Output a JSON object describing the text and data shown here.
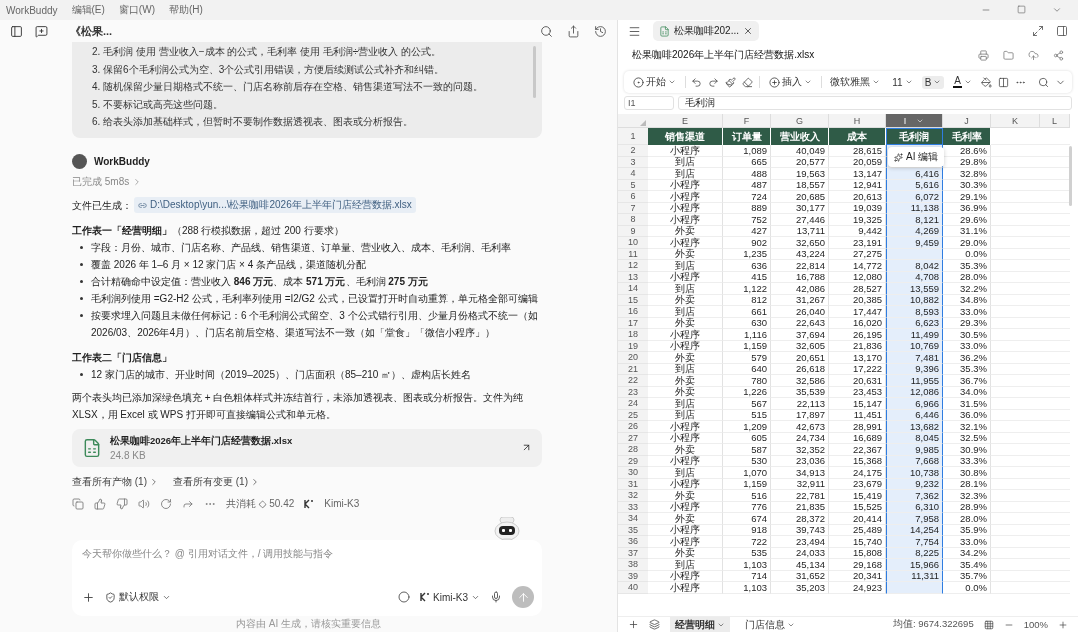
{
  "menu_bar": {
    "app": "WorkBuddy",
    "menus": [
      "编辑(E)",
      "窗口(W)",
      "帮助(H)"
    ]
  },
  "chat": {
    "title": "《松果...",
    "prompt_lines": [
      "2. 毛利润 使用 营业收入−成本 的公式，毛利率 使用 毛利润÷营业收入 的公式。",
      "3. 保留6个毛利润公式为空、3个公式引用错误，方便后续测试公式补齐和纠错。",
      "4. 随机保留少量日期格式不统一、门店名称前后存在空格、销售渠道写法不一致的问题。",
      "5. 不要标记或高亮这些问题。",
      "6. 给表头添加基础样式，但暂时不要制作数据透视表、图表或分析报告。"
    ],
    "assistant": {
      "name": "WorkBuddy",
      "status": "已完成 5m8s"
    },
    "file_label": "文件已生成：",
    "file_path": "D:\\Desktop\\yun...\\松果咖啡2026年上半年门店经营数据.xlsx",
    "sections": [
      {
        "title": "工作表一「经营明细」",
        "note": "（288 行模拟数据，超过 200 行要求）",
        "bullets": [
          "字段：月份、城市、门店名称、产品线、销售渠道、订单量、营业收入、成本、毛利润、毛利率",
          "覆盖 2026 年 1–6 月 × 12 家门店 × 4 条产品线，渠道随机分配",
          "合计精确命中设定值：营业收入 **846 万元**、成本 **571 万元**、毛利润 **275 万元**",
          "毛利润列使用 =G2-H2 公式，毛利率列使用 =I2/G2 公式，已设置打开时自动重算，单元格全部可编辑",
          "按要求埋入问题且未做任何标记：6 个毛利润公式留空、3 个公式错行引用、少量月份格式不统一（如 2026/03、2026年4月）、门店名前后空格、渠道写法不一致（如「堂食」「微信小程序」）"
        ]
      },
      {
        "title": "工作表二「门店信息」",
        "bullets": [
          "12 家门店的城市、开业时间（2019–2025）、门店面积（85–210 ㎡）、虚构店长姓名"
        ]
      }
    ],
    "summary": "两个表头均已添加深绿色填充 + 白色粗体样式并冻结首行，未添加透视表、图表或分析报告。文件为纯 XLSX，用 Excel 或 WPS 打开即可直接编辑公式和单元格。",
    "attachment": {
      "name": "松果咖啡2026年上半年门店经营数据.xlsx",
      "size": "24.8 KB"
    },
    "links": [
      "查看所有产物 (1)",
      "查看所有变更 (1)"
    ],
    "usage": "共消耗 ◇ 50.42",
    "usage_model": "Kimi-K3",
    "input": {
      "placeholder": "今天帮你做些什么？ @ 引用对话文件，/ 调用技能与指令",
      "permission": "默认权限",
      "model": "Kimi-K3"
    },
    "footer": "内容由 AI 生成，请核实重要信息"
  },
  "sheet": {
    "file_tab": {
      "label": "松果咖啡202...",
      "selected": true
    },
    "file_title": "松果咖啡2026年上半年门店经营数据.xlsx",
    "toolbar": {
      "start": "开始",
      "insert": "插入",
      "font": "微软雅黑",
      "size": "11",
      "bold": "B",
      "bold_selected": true,
      "color_letter": "A"
    },
    "cell_ref": "I1",
    "formula": "毛利润",
    "columns": [
      {
        "letter": "E",
        "selected": false
      },
      {
        "letter": "F",
        "selected": false
      },
      {
        "letter": "G",
        "selected": false
      },
      {
        "letter": "H",
        "selected": false
      },
      {
        "letter": "I",
        "selected": true
      },
      {
        "letter": "J",
        "selected": false
      },
      {
        "letter": "K",
        "selected": false
      },
      {
        "letter": "L",
        "selected": false
      }
    ],
    "header_row_num": "1",
    "headers": [
      "销售渠道",
      "订单量",
      "营业收入",
      "成本",
      "毛利润",
      "毛利率"
    ],
    "rows": [
      {
        "num": "2",
        "cells": [
          "小程序",
          "1,089",
          "40,049",
          "28,615",
          "",
          "28.6%"
        ]
      },
      {
        "num": "3",
        "cells": [
          "到店",
          "665",
          "20,577",
          "20,059",
          "",
          "29.8%"
        ]
      },
      {
        "num": "4",
        "cells": [
          "到店",
          "488",
          "19,563",
          "13,147",
          "6,416",
          "32.8%"
        ]
      },
      {
        "num": "5",
        "cells": [
          "小程序",
          "487",
          "18,557",
          "12,941",
          "5,616",
          "30.3%"
        ]
      },
      {
        "num": "6",
        "cells": [
          "小程序",
          "724",
          "20,685",
          "20,613",
          "6,072",
          "29.1%"
        ]
      },
      {
        "num": "7",
        "cells": [
          "小程序",
          "889",
          "30,177",
          "19,039",
          "11,138",
          "36.9%"
        ]
      },
      {
        "num": "8",
        "cells": [
          "小程序",
          "752",
          "27,446",
          "19,325",
          "8,121",
          "29.6%"
        ]
      },
      {
        "num": "9",
        "cells": [
          "外卖",
          "427",
          "13,711",
          "9,442",
          "4,269",
          "31.1%"
        ]
      },
      {
        "num": "10",
        "cells": [
          "小程序",
          "902",
          "32,650",
          "23,191",
          "9,459",
          "29.0%"
        ]
      },
      {
        "num": "11",
        "cells": [
          "外卖",
          "1,235",
          "43,224",
          "27,275",
          "",
          "0.0%"
        ]
      },
      {
        "num": "12",
        "cells": [
          "到店",
          "636",
          "22,814",
          "14,772",
          "8,042",
          "35.3%"
        ]
      },
      {
        "num": "13",
        "cells": [
          "小程序",
          "415",
          "16,788",
          "12,080",
          "4,708",
          "28.0%"
        ]
      },
      {
        "num": "14",
        "cells": [
          "到店",
          "1,122",
          "42,086",
          "28,527",
          "13,559",
          "32.2%"
        ]
      },
      {
        "num": "15",
        "cells": [
          "外卖",
          "812",
          "31,267",
          "20,385",
          "10,882",
          "34.8%"
        ]
      },
      {
        "num": "16",
        "cells": [
          "到店",
          "661",
          "26,040",
          "17,447",
          "8,593",
          "33.0%"
        ]
      },
      {
        "num": "17",
        "cells": [
          "外卖",
          "630",
          "22,643",
          "16,020",
          "6,623",
          "29.3%"
        ]
      },
      {
        "num": "18",
        "cells": [
          "小程序",
          "1,116",
          "37,694",
          "26,195",
          "11,499",
          "30.5%"
        ]
      },
      {
        "num": "19",
        "cells": [
          "小程序",
          "1,159",
          "32,605",
          "21,836",
          "10,769",
          "33.0%"
        ]
      },
      {
        "num": "20",
        "cells": [
          "外卖",
          "579",
          "20,651",
          "13,170",
          "7,481",
          "36.2%"
        ]
      },
      {
        "num": "21",
        "cells": [
          "到店",
          "640",
          "26,618",
          "17,222",
          "9,396",
          "35.3%"
        ]
      },
      {
        "num": "22",
        "cells": [
          "外卖",
          "780",
          "32,586",
          "20,631",
          "11,955",
          "36.7%"
        ]
      },
      {
        "num": "23",
        "cells": [
          "外卖",
          "1,226",
          "35,539",
          "23,453",
          "12,086",
          "34.0%"
        ]
      },
      {
        "num": "24",
        "cells": [
          "到店",
          "567",
          "22,113",
          "15,147",
          "6,966",
          "31.5%"
        ]
      },
      {
        "num": "25",
        "cells": [
          "到店",
          "515",
          "17,897",
          "11,451",
          "6,446",
          "36.0%"
        ]
      },
      {
        "num": "26",
        "cells": [
          "小程序",
          "1,209",
          "42,673",
          "28,991",
          "13,682",
          "32.1%"
        ]
      },
      {
        "num": "27",
        "cells": [
          "小程序",
          "605",
          "24,734",
          "16,689",
          "8,045",
          "32.5%"
        ]
      },
      {
        "num": "28",
        "cells": [
          "外卖",
          "587",
          "32,352",
          "22,367",
          "9,985",
          "30.9%"
        ]
      },
      {
        "num": "29",
        "cells": [
          "小程序",
          "530",
          "23,036",
          "15,368",
          "7,668",
          "33.3%"
        ]
      },
      {
        "num": "30",
        "cells": [
          "到店",
          "1,070",
          "34,913",
          "24,175",
          "10,738",
          "30.8%"
        ]
      },
      {
        "num": "31",
        "cells": [
          "小程序",
          "1,159",
          "32,911",
          "23,679",
          "9,232",
          "28.1%"
        ]
      },
      {
        "num": "32",
        "cells": [
          "外卖",
          "516",
          "22,781",
          "15,419",
          "7,362",
          "32.3%"
        ]
      },
      {
        "num": "33",
        "cells": [
          "小程序",
          "776",
          "21,835",
          "15,525",
          "6,310",
          "28.9%"
        ]
      },
      {
        "num": "34",
        "cells": [
          "外卖",
          "674",
          "28,372",
          "20,414",
          "7,958",
          "28.0%"
        ]
      },
      {
        "num": "35",
        "cells": [
          "小程序",
          "918",
          "39,743",
          "25,489",
          "14,254",
          "35.9%"
        ]
      },
      {
        "num": "36",
        "cells": [
          "小程序",
          "722",
          "23,494",
          "15,740",
          "7,754",
          "33.0%"
        ]
      },
      {
        "num": "37",
        "cells": [
          "外卖",
          "535",
          "24,033",
          "15,808",
          "8,225",
          "34.2%"
        ]
      },
      {
        "num": "38",
        "cells": [
          "到店",
          "1,103",
          "45,134",
          "29,168",
          "15,966",
          "35.4%"
        ]
      },
      {
        "num": "39",
        "cells": [
          "小程序",
          "714",
          "31,652",
          "20,341",
          "11,311",
          "35.7%"
        ]
      },
      {
        "num": "40",
        "cells": [
          "小程序",
          "1,103",
          "35,203",
          "24,923",
          "",
          "0.0%"
        ]
      }
    ],
    "ai_popup": "AI 编辑",
    "sheet_tabs": [
      {
        "label": "经营明细",
        "selected": true
      },
      {
        "label": "门店信息",
        "selected": false
      }
    ],
    "status": "均值: 9674.322695",
    "zoom": "100%"
  }
}
